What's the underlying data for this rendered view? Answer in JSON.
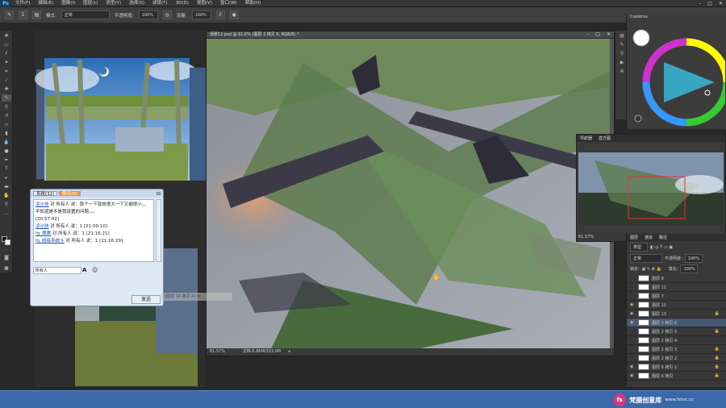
{
  "app": {
    "logo": "Ps"
  },
  "menu": [
    "文件(F)",
    "编辑(E)",
    "图像(I)",
    "图层(L)",
    "类型(Y)",
    "选择(S)",
    "滤镜(T)",
    "3D(D)",
    "视图(V)",
    "窗口(W)",
    "帮助(H)"
  ],
  "options": {
    "mode_label": "模式:",
    "mode_value": "正常",
    "opacity_label": "不透明度:",
    "opacity_value": "100%",
    "flow_label": "流量:",
    "flow_value": "100%",
    "brush_size": "1"
  },
  "document": {
    "title": "场景12.psd @ 61.6% (图层 2 拷贝 6, RGB/8) *",
    "zoom": "61.57%",
    "status": "文档:6.86M/333.9M"
  },
  "color_panel": {
    "title": "Coolorus"
  },
  "navigator": {
    "tabs": [
      "导航器",
      "直方图"
    ],
    "zoom": "61.57%"
  },
  "layers_panel": {
    "tabs": [
      "图层",
      "通道",
      "路径"
    ],
    "kind_label": "类型",
    "blend": "正常",
    "opacity_label": "不透明度:",
    "opacity_value": "100%",
    "lock_label": "锁定:",
    "fill_label": "填充:",
    "fill_value": "100%",
    "rows": [
      {
        "name": "图层 8",
        "visible": false,
        "locked": false,
        "selected": false
      },
      {
        "name": "图层 11",
        "visible": false,
        "locked": false,
        "selected": false
      },
      {
        "name": "图层 7",
        "visible": false,
        "locked": false,
        "selected": false
      },
      {
        "name": "图层 10",
        "visible": true,
        "locked": false,
        "selected": false
      },
      {
        "name": "图层 13",
        "visible": true,
        "locked": true,
        "selected": false
      },
      {
        "name": "图层 2 拷贝 6",
        "visible": true,
        "locked": false,
        "selected": true
      },
      {
        "name": "图层 2 拷贝 5",
        "visible": false,
        "locked": true,
        "selected": false
      },
      {
        "name": "图层 2 拷贝 4",
        "visible": false,
        "locked": false,
        "selected": false
      },
      {
        "name": "图层 2 拷贝 3",
        "visible": false,
        "locked": true,
        "selected": false
      },
      {
        "name": "图层 2 拷贝 2",
        "visible": false,
        "locked": true,
        "selected": false
      },
      {
        "name": "图层 6 拷贝 2",
        "visible": true,
        "locked": true,
        "selected": false
      },
      {
        "name": "图层 6 拷贝",
        "visible": true,
        "locked": true,
        "selected": false
      }
    ]
  },
  "chat": {
    "tabs": [
      {
        "label": "系统(32)",
        "active": false
      },
      {
        "label": "聊天(0)",
        "active": true
      }
    ],
    "messages": [
      {
        "name": "凌沙烧",
        "text": " 对 所有人 说：那个一下就效很大一下又缩很小，，不知道是不是我设置的问题。。。"
      },
      {
        "name": "",
        "text": "[20:57:02]"
      },
      {
        "name": "凌沙烧",
        "text": " 对 所有人 说：1 [21:00:10]"
      },
      {
        "name": "fq_鹰鹰",
        "text": " 对 所有人 说：1 [21:16:21]"
      },
      {
        "name": "fq_超级系统斗",
        "text": " 对 所有人 说：1 [21:16:29]"
      }
    ],
    "recipient": "所有人",
    "send_label": "发送"
  },
  "hidden_label": "[图层 14 拷贝 4]",
  "brand": {
    "logo": "fs",
    "name": "梵摄创意库",
    "url": "www.fstvc.cc"
  },
  "colors": {
    "accent": "#3a68a8",
    "selected_layer": "#475a72",
    "chat_tab_active": "#f09a4c"
  }
}
